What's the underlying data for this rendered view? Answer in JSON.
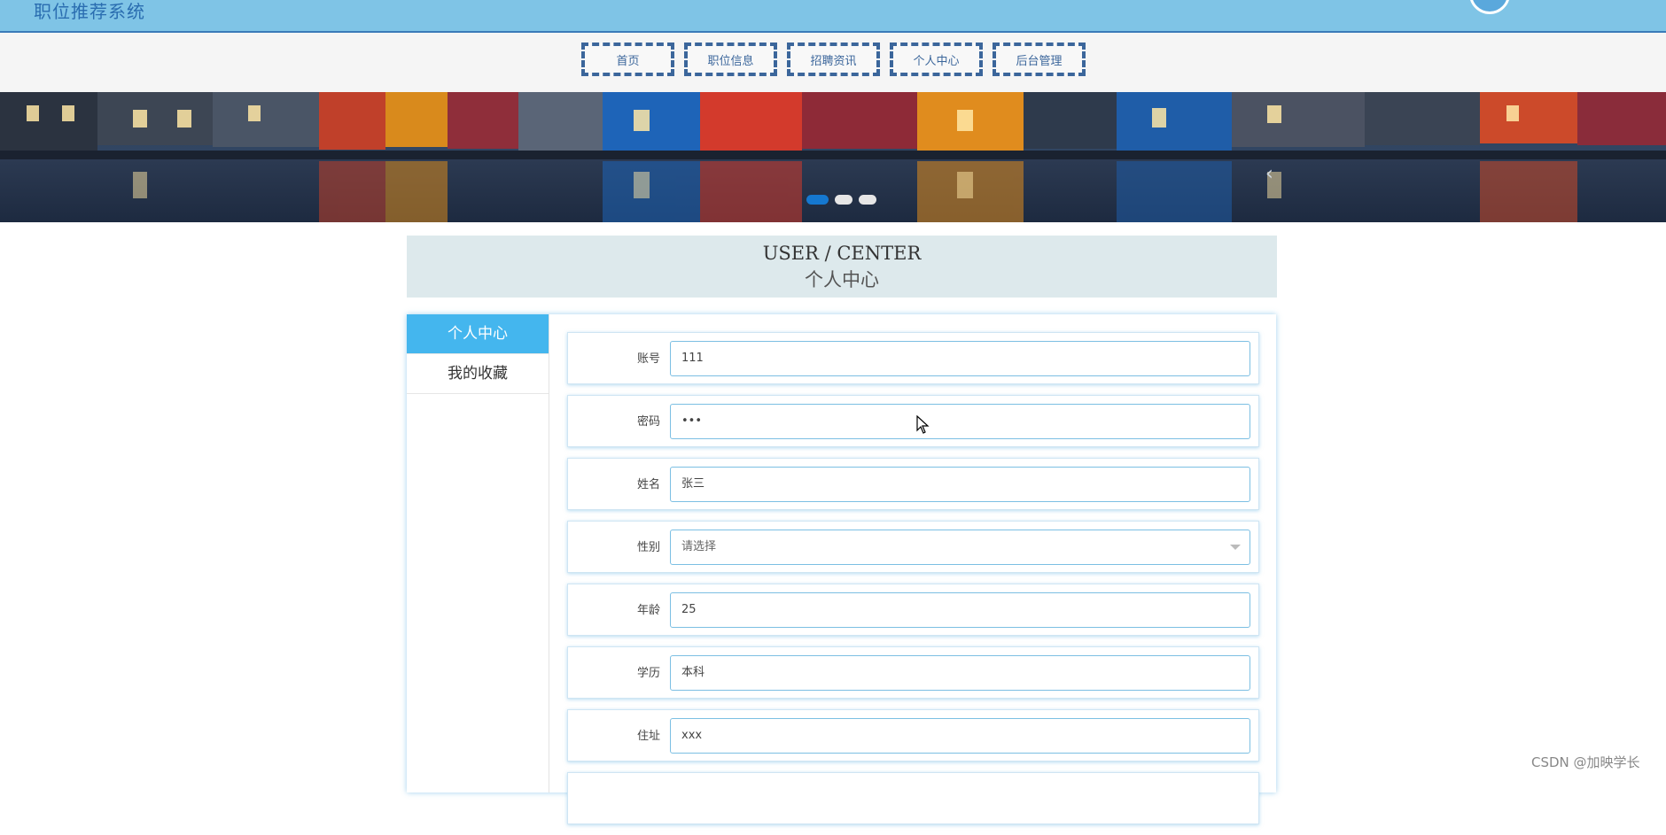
{
  "header": {
    "site_title": "职位推荐系统"
  },
  "nav": {
    "items": [
      "首页",
      "职位信息",
      "招聘资讯",
      "个人中心",
      "后台管理"
    ]
  },
  "banner": {
    "slides": 3,
    "active_slide": 1
  },
  "section": {
    "title_en": "USER / CENTER",
    "title_cn": "个人中心"
  },
  "sidebar": {
    "items": [
      {
        "label": "个人中心",
        "active": true
      },
      {
        "label": "我的收藏",
        "active": false
      }
    ]
  },
  "form": {
    "fields": [
      {
        "label": "账号",
        "value": "111",
        "type": "text"
      },
      {
        "label": "密码",
        "value": "•••",
        "type": "password"
      },
      {
        "label": "姓名",
        "value": "张三",
        "type": "text"
      },
      {
        "label": "性别",
        "value": "请选择",
        "type": "select"
      },
      {
        "label": "年龄",
        "value": "25",
        "type": "text"
      },
      {
        "label": "学历",
        "value": "本科",
        "type": "text"
      },
      {
        "label": "住址",
        "value": "xxx",
        "type": "text"
      }
    ]
  },
  "watermark": "CSDN @加映学长",
  "colors": {
    "header_bg": "#7fc4e6",
    "accent": "#44b6ee",
    "nav_border": "#3b669b"
  }
}
